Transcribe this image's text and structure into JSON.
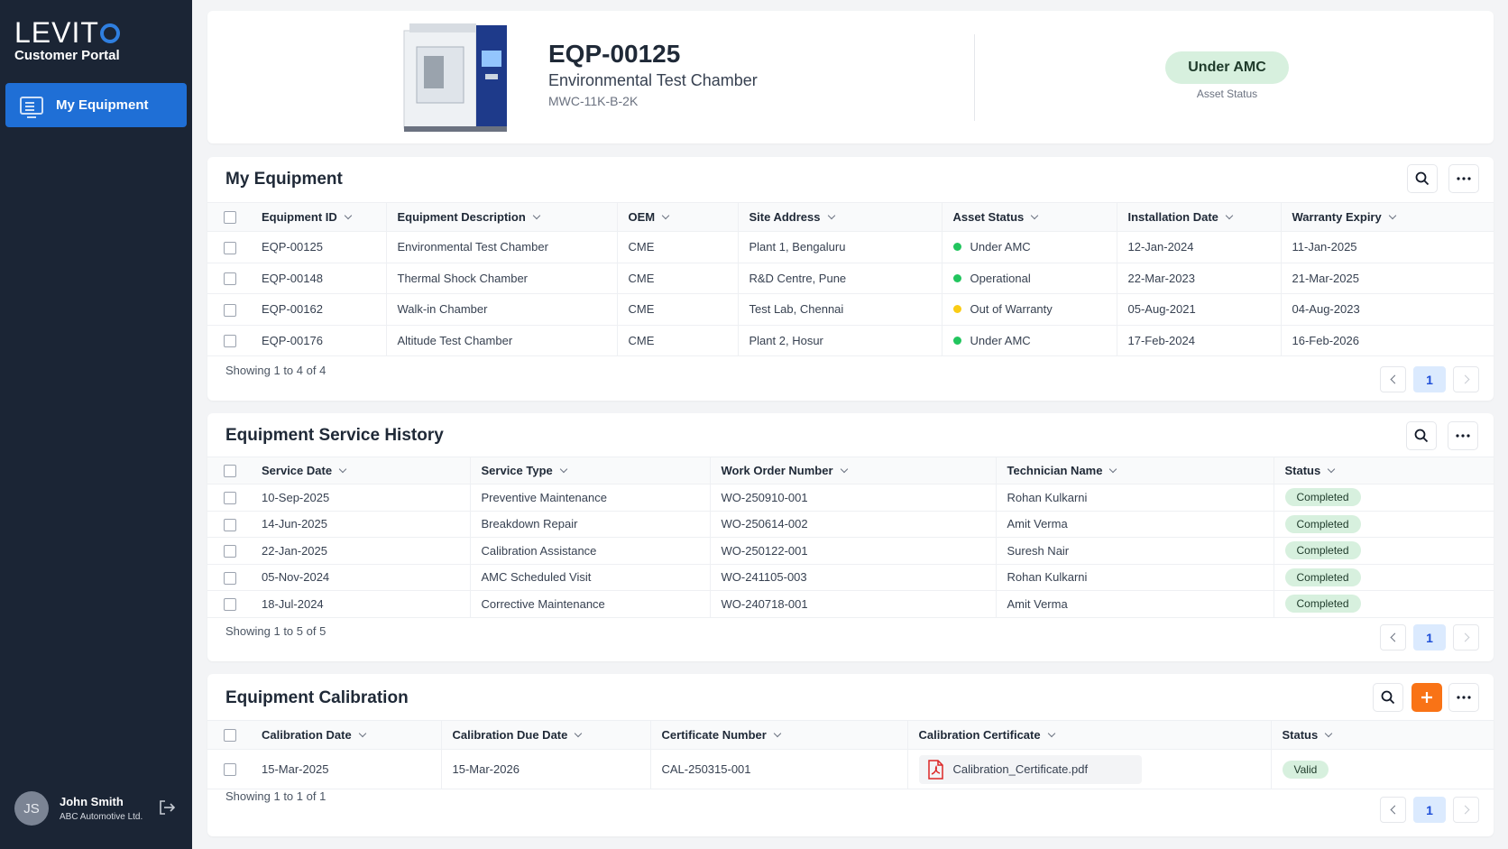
{
  "sidebar": {
    "brand_name": "LEVIT",
    "brand_sub": "Customer Portal",
    "nav": [
      {
        "label": "My Equipment",
        "icon": "monitor-icon"
      }
    ],
    "user": {
      "initials": "JS",
      "name": "John Smith",
      "org": "ABC Automotive Ltd."
    }
  },
  "hero": {
    "equipment_id": "EQP-00125",
    "description": "Environmental Test Chamber",
    "model": "MWC-11K-B-2K",
    "status": "Under AMC",
    "status_caption": "Asset Status"
  },
  "equipment": {
    "title": "My Equipment",
    "columns": [
      "Equipment ID",
      "Equipment Description",
      "OEM",
      "Site Address",
      "Asset Status",
      "Installation Date",
      "Warranty Expiry"
    ],
    "rows": [
      {
        "id": "EQP-00125",
        "desc": "Environmental Test Chamber",
        "oem": "CME",
        "site": "Plant 1, Bengaluru",
        "status": "Under AMC",
        "status_color": "#22c55e",
        "install": "12-Jan-2024",
        "warranty": "11-Jan-2025"
      },
      {
        "id": "EQP-00148",
        "desc": "Thermal Shock Chamber",
        "oem": "CME",
        "site": "R&D Centre, Pune",
        "status": "Operational",
        "status_color": "#22c55e",
        "install": "22-Mar-2023",
        "warranty": "21-Mar-2025"
      },
      {
        "id": "EQP-00162",
        "desc": "Walk-in Chamber",
        "oem": "CME",
        "site": "Test Lab, Chennai",
        "status": "Out of Warranty",
        "status_color": "#facc15",
        "install": "05-Aug-2021",
        "warranty": "04-Aug-2023"
      },
      {
        "id": "EQP-00176",
        "desc": "Altitude Test Chamber",
        "oem": "CME",
        "site": "Plant 2, Hosur",
        "status": "Under AMC",
        "status_color": "#22c55e",
        "install": "17-Feb-2024",
        "warranty": "16-Feb-2026"
      }
    ],
    "showing": "Showing 1 to 4 of 4",
    "page": "1"
  },
  "service": {
    "title": "Equipment Service History",
    "columns": [
      "Service Date",
      "Service Type",
      "Work Order Number",
      "Technician Name",
      "Status"
    ],
    "rows": [
      {
        "date": "10-Sep-2025",
        "type": "Preventive Maintenance",
        "wo": "WO-250910-001",
        "tech": "Rohan Kulkarni",
        "status": "Completed"
      },
      {
        "date": "14-Jun-2025",
        "type": "Breakdown Repair",
        "wo": "WO-250614-002",
        "tech": "Amit Verma",
        "status": "Completed"
      },
      {
        "date": "22-Jan-2025",
        "type": "Calibration Assistance",
        "wo": "WO-250122-001",
        "tech": "Suresh Nair",
        "status": "Completed"
      },
      {
        "date": "05-Nov-2024",
        "type": "AMC Scheduled Visit",
        "wo": "WO-241105-003",
        "tech": "Rohan Kulkarni",
        "status": "Completed"
      },
      {
        "date": "18-Jul-2024",
        "type": "Corrective Maintenance",
        "wo": "WO-240718-001",
        "tech": "Amit Verma",
        "status": "Completed"
      }
    ],
    "showing": "Showing 1 to 5 of 5",
    "page": "1"
  },
  "calibration": {
    "title": "Equipment Calibration",
    "columns": [
      "Calibration Date",
      "Calibration Due Date",
      "Certificate Number",
      "Calibration Certificate",
      "Status"
    ],
    "rows": [
      {
        "date": "15-Mar-2025",
        "due": "15-Mar-2026",
        "cert_no": "CAL-250315-001",
        "file": "Calibration_Certificate.pdf",
        "status": "Valid"
      }
    ],
    "showing": "Showing 1 to 1 of 1",
    "page": "1"
  },
  "colors": {
    "sidebar": "#1b2535",
    "accent": "#1f6fd6",
    "success_bg": "#d7f0de",
    "add_button": "#f97316"
  }
}
